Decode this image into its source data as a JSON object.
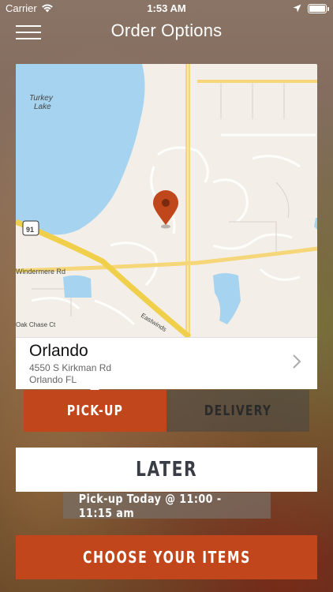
{
  "status_bar": {
    "carrier": "Carrier",
    "time": "1:53 AM",
    "battery_level": 1.0
  },
  "nav": {
    "title": "Order Options",
    "menu_icon": "hamburger-menu-icon"
  },
  "map": {
    "lake_label_line1": "Turkey",
    "lake_label_line2": "Lake",
    "highway_shield": "91",
    "road_windermere": "Windermere Rd",
    "road_oak_chase": "Oak Chase Ct",
    "road_eastwinds": "Eastwinds",
    "pin_icon": "location-pin-icon",
    "colors": {
      "water": "#a6d4f0",
      "land": "#f3efe8",
      "major_road": "#f5d77a",
      "highway": "#f0cf4a",
      "pin": "#c0461c"
    }
  },
  "location": {
    "city": "Orlando",
    "address": "4550 S Kirkman Rd",
    "city_state": "Orlando FL"
  },
  "order_type": {
    "pickup_label": "PICK-UP",
    "delivery_label": "DELIVERY",
    "selected": "pickup"
  },
  "timing": {
    "later_label": "LATER",
    "pickup_time_text": "Pick-up Today @ 11:00 - 11:15 am"
  },
  "actions": {
    "choose_items_label": "CHOOSE YOUR ITEMS"
  },
  "colors": {
    "accent": "#c1461c"
  }
}
